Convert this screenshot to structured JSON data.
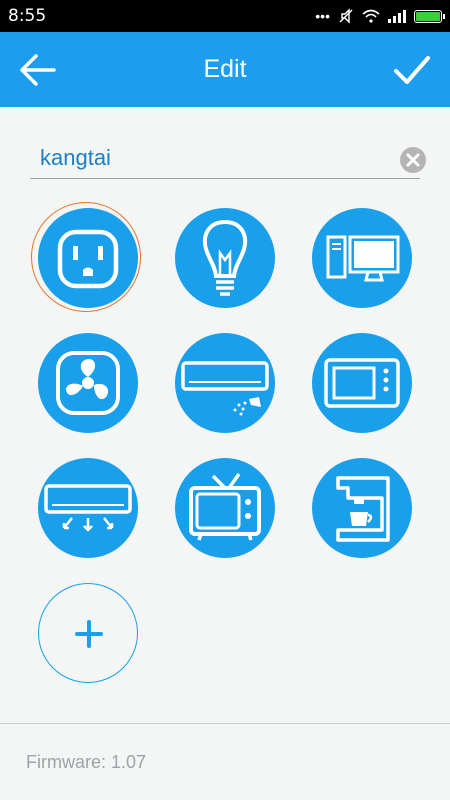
{
  "status_bar": {
    "time": "8:55",
    "battery_color": "#39d13a"
  },
  "header": {
    "title": "Edit",
    "background": "#1d9ded",
    "back_icon": "arrow-left-icon",
    "confirm_icon": "checkmark-icon"
  },
  "name_input": {
    "value": "kangtai",
    "clear_icon": "clear-x-icon"
  },
  "device_icons": [
    {
      "name": "outlet-icon",
      "selected": true
    },
    {
      "name": "light-bulb-icon",
      "selected": false
    },
    {
      "name": "computer-icon",
      "selected": false
    },
    {
      "name": "fan-icon",
      "selected": false
    },
    {
      "name": "humidifier-icon",
      "selected": false
    },
    {
      "name": "microwave-icon",
      "selected": false
    },
    {
      "name": "air-conditioner-icon",
      "selected": false
    },
    {
      "name": "tv-icon",
      "selected": false
    },
    {
      "name": "coffee-maker-icon",
      "selected": false
    }
  ],
  "add_icon": "plus-icon",
  "footer": {
    "firmware": "Firmware: 1.07"
  },
  "colors": {
    "accent": "#1a9fea",
    "selection_ring": "#e8742a",
    "text_blue": "#1d7fc4"
  }
}
